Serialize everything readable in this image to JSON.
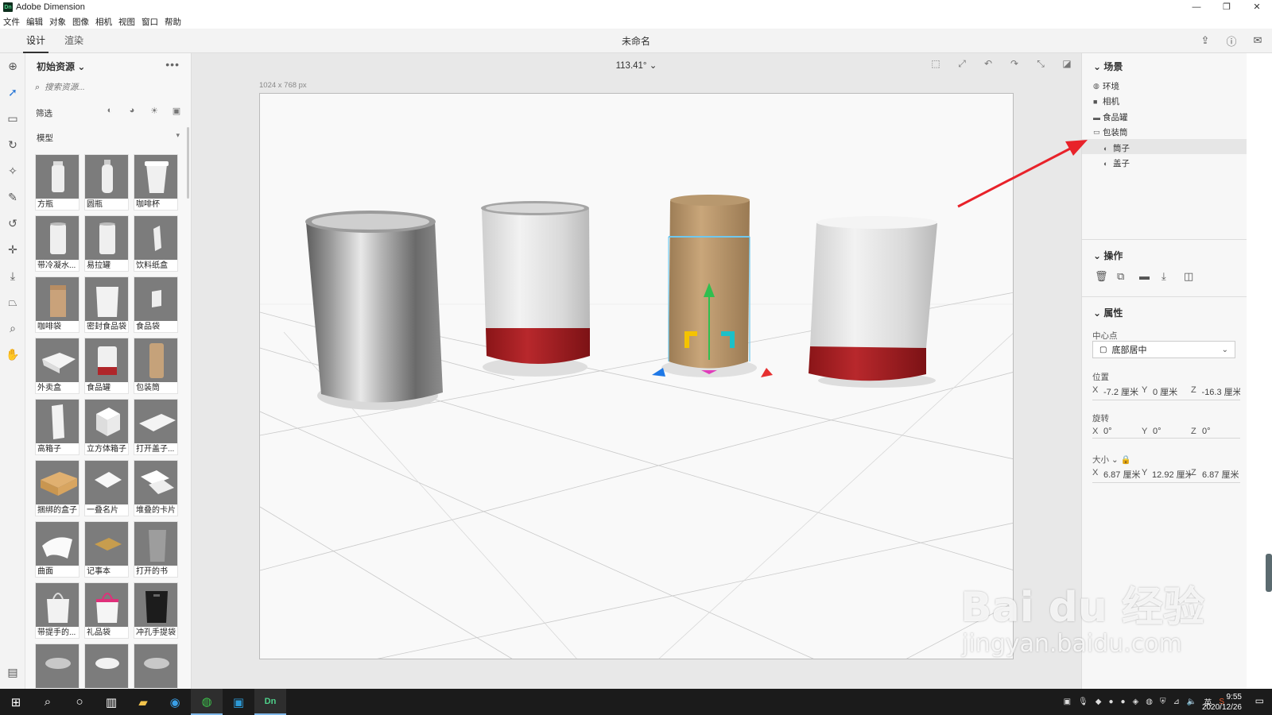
{
  "app": {
    "title": "Adobe Dimension",
    "logo": "Dn"
  },
  "window_buttons": [
    "—",
    "❐",
    "✕"
  ],
  "menu": [
    "文件",
    "编辑",
    "对象",
    "图像",
    "相机",
    "视图",
    "窗口",
    "帮助"
  ],
  "tabs": [
    {
      "label": "设计",
      "active": true
    },
    {
      "label": "渲染",
      "active": false
    }
  ],
  "document": {
    "name": "未命名"
  },
  "top_icons": [
    "share-icon",
    "help-icon",
    "feedback-icon"
  ],
  "left_tools": [
    "add-icon",
    "select-icon",
    "magic-select-icon",
    "orbit-icon",
    "wand-icon",
    "eyedropper-icon",
    "lasso-icon",
    "move-icon",
    "drop-icon",
    "perspective-icon",
    "zoom-icon",
    "hand-icon"
  ],
  "assets": {
    "header": "初始资源",
    "search_placeholder": "搜索资源...",
    "filter_label": "筛选",
    "section": "模型",
    "items": [
      {
        "label": "方瓶",
        "shape": "bottle"
      },
      {
        "label": "圆瓶",
        "shape": "bottle2"
      },
      {
        "label": "咖啡杯",
        "shape": "cup"
      },
      {
        "label": "带冷凝水...",
        "shape": "can"
      },
      {
        "label": "易拉罐",
        "shape": "can"
      },
      {
        "label": "饮料纸盒",
        "shape": "carton"
      },
      {
        "label": "咖啡袋",
        "shape": "bag"
      },
      {
        "label": "密封食品袋",
        "shape": "pouch"
      },
      {
        "label": "食品袋",
        "shape": "pouchs"
      },
      {
        "label": "外卖盒",
        "shape": "takeout"
      },
      {
        "label": "食品罐",
        "shape": "jar"
      },
      {
        "label": "包装筒",
        "shape": "tube"
      },
      {
        "label": "高箱子",
        "shape": "tallbox"
      },
      {
        "label": "立方体箱子",
        "shape": "cube"
      },
      {
        "label": "打开盖子...",
        "shape": "openbox"
      },
      {
        "label": "捆绑的盒子",
        "shape": "parcel"
      },
      {
        "label": "一叠名片",
        "shape": "cards"
      },
      {
        "label": "堆叠的卡片",
        "shape": "cards2"
      },
      {
        "label": "曲面",
        "shape": "sheet"
      },
      {
        "label": "记事本",
        "shape": "notebook"
      },
      {
        "label": "打开的书",
        "shape": "book"
      },
      {
        "label": "带提手的...",
        "shape": "shopbag"
      },
      {
        "label": "礼品袋",
        "shape": "giftbag"
      },
      {
        "label": "冲孔手提袋",
        "shape": "blackbag"
      },
      {
        "label": "",
        "shape": "lid"
      },
      {
        "label": "",
        "shape": "bowl"
      },
      {
        "label": "",
        "shape": "lid"
      }
    ]
  },
  "viewport": {
    "zoom": "113.41°",
    "dims": "1024 x 768 px"
  },
  "scene": {
    "title": "场景",
    "tree": [
      {
        "label": "环境",
        "icon": "globe-icon",
        "depth": 0,
        "selected": false
      },
      {
        "label": "相机",
        "icon": "camera-icon",
        "depth": 0,
        "selected": false
      },
      {
        "label": "食品罐",
        "icon": "folder-icon",
        "depth": 0,
        "selected": false
      },
      {
        "label": "包装筒",
        "icon": "folder-open-icon",
        "depth": 0,
        "selected": false
      },
      {
        "label": "筒子",
        "icon": "mesh-icon",
        "depth": 1,
        "selected": true
      },
      {
        "label": "盖子",
        "icon": "mesh-icon",
        "depth": 1,
        "selected": false
      }
    ]
  },
  "actions": {
    "title": "操作",
    "icons": [
      "delete-icon",
      "duplicate-icon",
      "group-icon",
      "drop-to-ground-icon",
      "export-icon"
    ]
  },
  "properties": {
    "title": "属性",
    "pivot_label": "中心点",
    "pivot_value": "底部居中",
    "position_label": "位置",
    "position": {
      "x": "-7.2 厘米",
      "y": "0 厘米",
      "z": "-16.3 厘米"
    },
    "rotation_label": "旋转",
    "rotation": {
      "x": "0°",
      "y": "0°",
      "z": "0°"
    },
    "size_label": "大小",
    "size": {
      "x": "6.87 厘米",
      "y": "12.92 厘米",
      "z": "6.87 厘米"
    }
  },
  "taskbar": {
    "apps": [
      "windows-icon",
      "search-icon",
      "cortana-icon",
      "taskview-icon",
      "explorer-icon",
      "edge-icon",
      "wechat-icon",
      "app-icon",
      "dimension-icon"
    ],
    "tray_lang": "英",
    "time": "9:55",
    "date": "2020/12/26"
  },
  "watermark": {
    "line1": "Bai du 经验",
    "line2": "jingyan.baidu.com"
  },
  "colors": {
    "accent": "#2a78d6",
    "arrow": "#e8222a",
    "can_red": "#a21e22",
    "kraft": "#b4946a"
  }
}
